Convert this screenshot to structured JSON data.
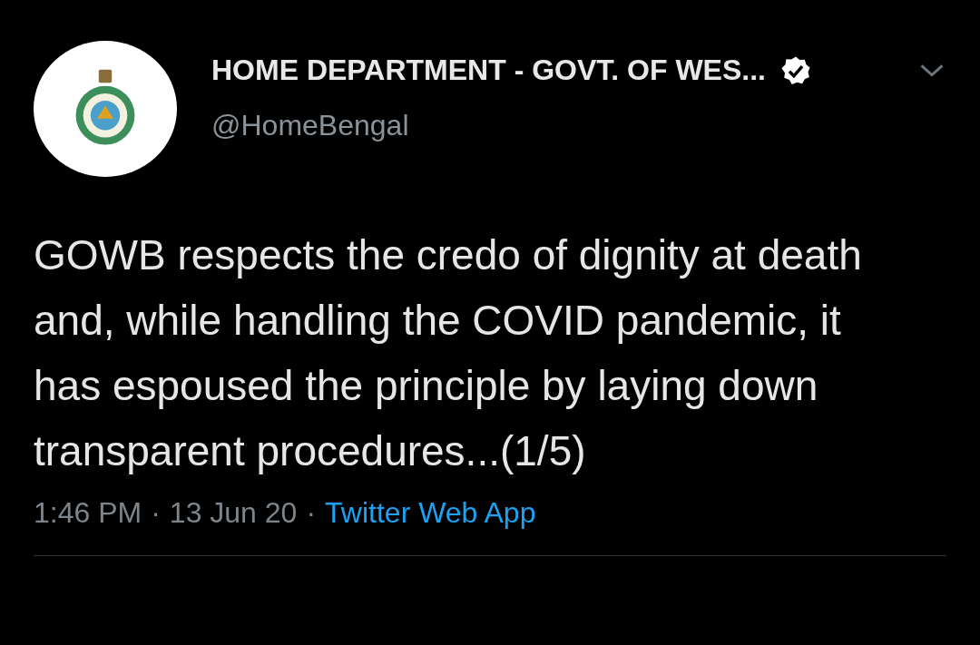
{
  "tweet": {
    "author_name": "HOME DEPARTMENT - GOVT. OF WES...",
    "verified": true,
    "handle": "@HomeBengal",
    "text": "GOWB respects the credo of dignity at death and, while handling the COVID pandemic, it has espoused the principle by laying down transparent procedures...(1/5)",
    "time": "1:46 PM",
    "separator_1": "·",
    "date": "13 Jun 20",
    "separator_2": "·",
    "source": "Twitter Web App"
  }
}
